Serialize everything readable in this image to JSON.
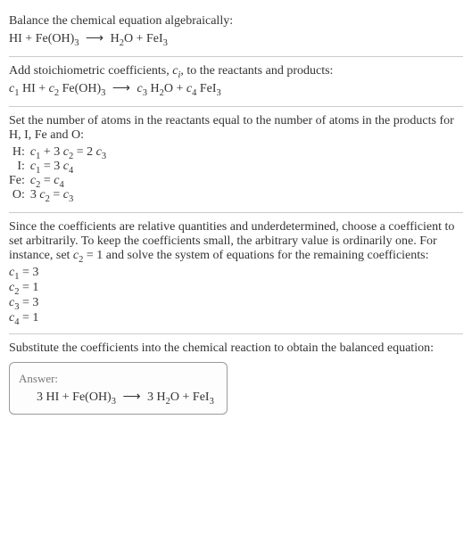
{
  "section1": {
    "prompt": "Balance the chemical equation algebraically:",
    "lhs1": "HI",
    "lhs2_pre": "Fe(OH)",
    "lhs2_sub": "3",
    "rhs1_pre": "H",
    "rhs1_sub": "2",
    "rhs1_post": "O",
    "rhs2_pre": "FeI",
    "rhs2_sub": "3"
  },
  "section2": {
    "text_a": "Add stoichiometric coefficients, ",
    "ci_c": "c",
    "ci_i": "i",
    "text_b": ", to the reactants and products:",
    "c1": "c",
    "c1s": "1",
    "sp1": " HI + ",
    "c2": "c",
    "c2s": "2",
    "sp2_pre": " Fe(OH)",
    "sp2_sub": "3",
    "arr": "⟶",
    "c3": "c",
    "c3s": "3",
    "sp3_pre": " H",
    "sp3_sub": "2",
    "sp3_post": "O + ",
    "c4": "c",
    "c4s": "4",
    "sp4_pre": " FeI",
    "sp4_sub": "3"
  },
  "section3": {
    "text": "Set the number of atoms in the reactants equal to the number of atoms in the products for H, I, Fe and O:",
    "rows": {
      "h_label": "H:",
      "h_l1": "c",
      "h_l1s": "1",
      "h_plus": " + 3 ",
      "h_l2": "c",
      "h_l2s": "2",
      "h_eq": " = 2 ",
      "h_r": "c",
      "h_rs": "3",
      "i_label": "I:",
      "i_l": "c",
      "i_ls": "1",
      "i_eq": " = 3 ",
      "i_r": "c",
      "i_rs": "4",
      "fe_label": "Fe:",
      "fe_l": "c",
      "fe_ls": "2",
      "fe_eq": " = ",
      "fe_r": "c",
      "fe_rs": "4",
      "o_label": "O:",
      "o_pre": "3 ",
      "o_l": "c",
      "o_ls": "2",
      "o_eq": " = ",
      "o_r": "c",
      "o_rs": "3"
    }
  },
  "section4": {
    "text_a": "Since the coefficients are relative quantities and underdetermined, choose a coefficient to set arbitrarily. To keep the coefficients small, the arbitrary value is ordinarily one. For instance, set ",
    "cset": "c",
    "cset_s": "2",
    "cset_val": " = 1",
    "text_b": " and solve the system of equations for the remaining coefficients:",
    "r1a": "c",
    "r1s": "1",
    "r1b": " = 3",
    "r2a": "c",
    "r2s": "2",
    "r2b": " = 1",
    "r3a": "c",
    "r3s": "3",
    "r3b": " = 3",
    "r4a": "c",
    "r4s": "4",
    "r4b": " = 1"
  },
  "section5": {
    "text": "Substitute the coefficients into the chemical reaction to obtain the balanced equation:"
  },
  "answer": {
    "title": "Answer:",
    "l1": "3 HI + Fe(OH)",
    "l1s": "3",
    "arr": "⟶",
    "r1a": "3 H",
    "r1s": "2",
    "r1b": "O + FeI",
    "r2s": "3"
  }
}
